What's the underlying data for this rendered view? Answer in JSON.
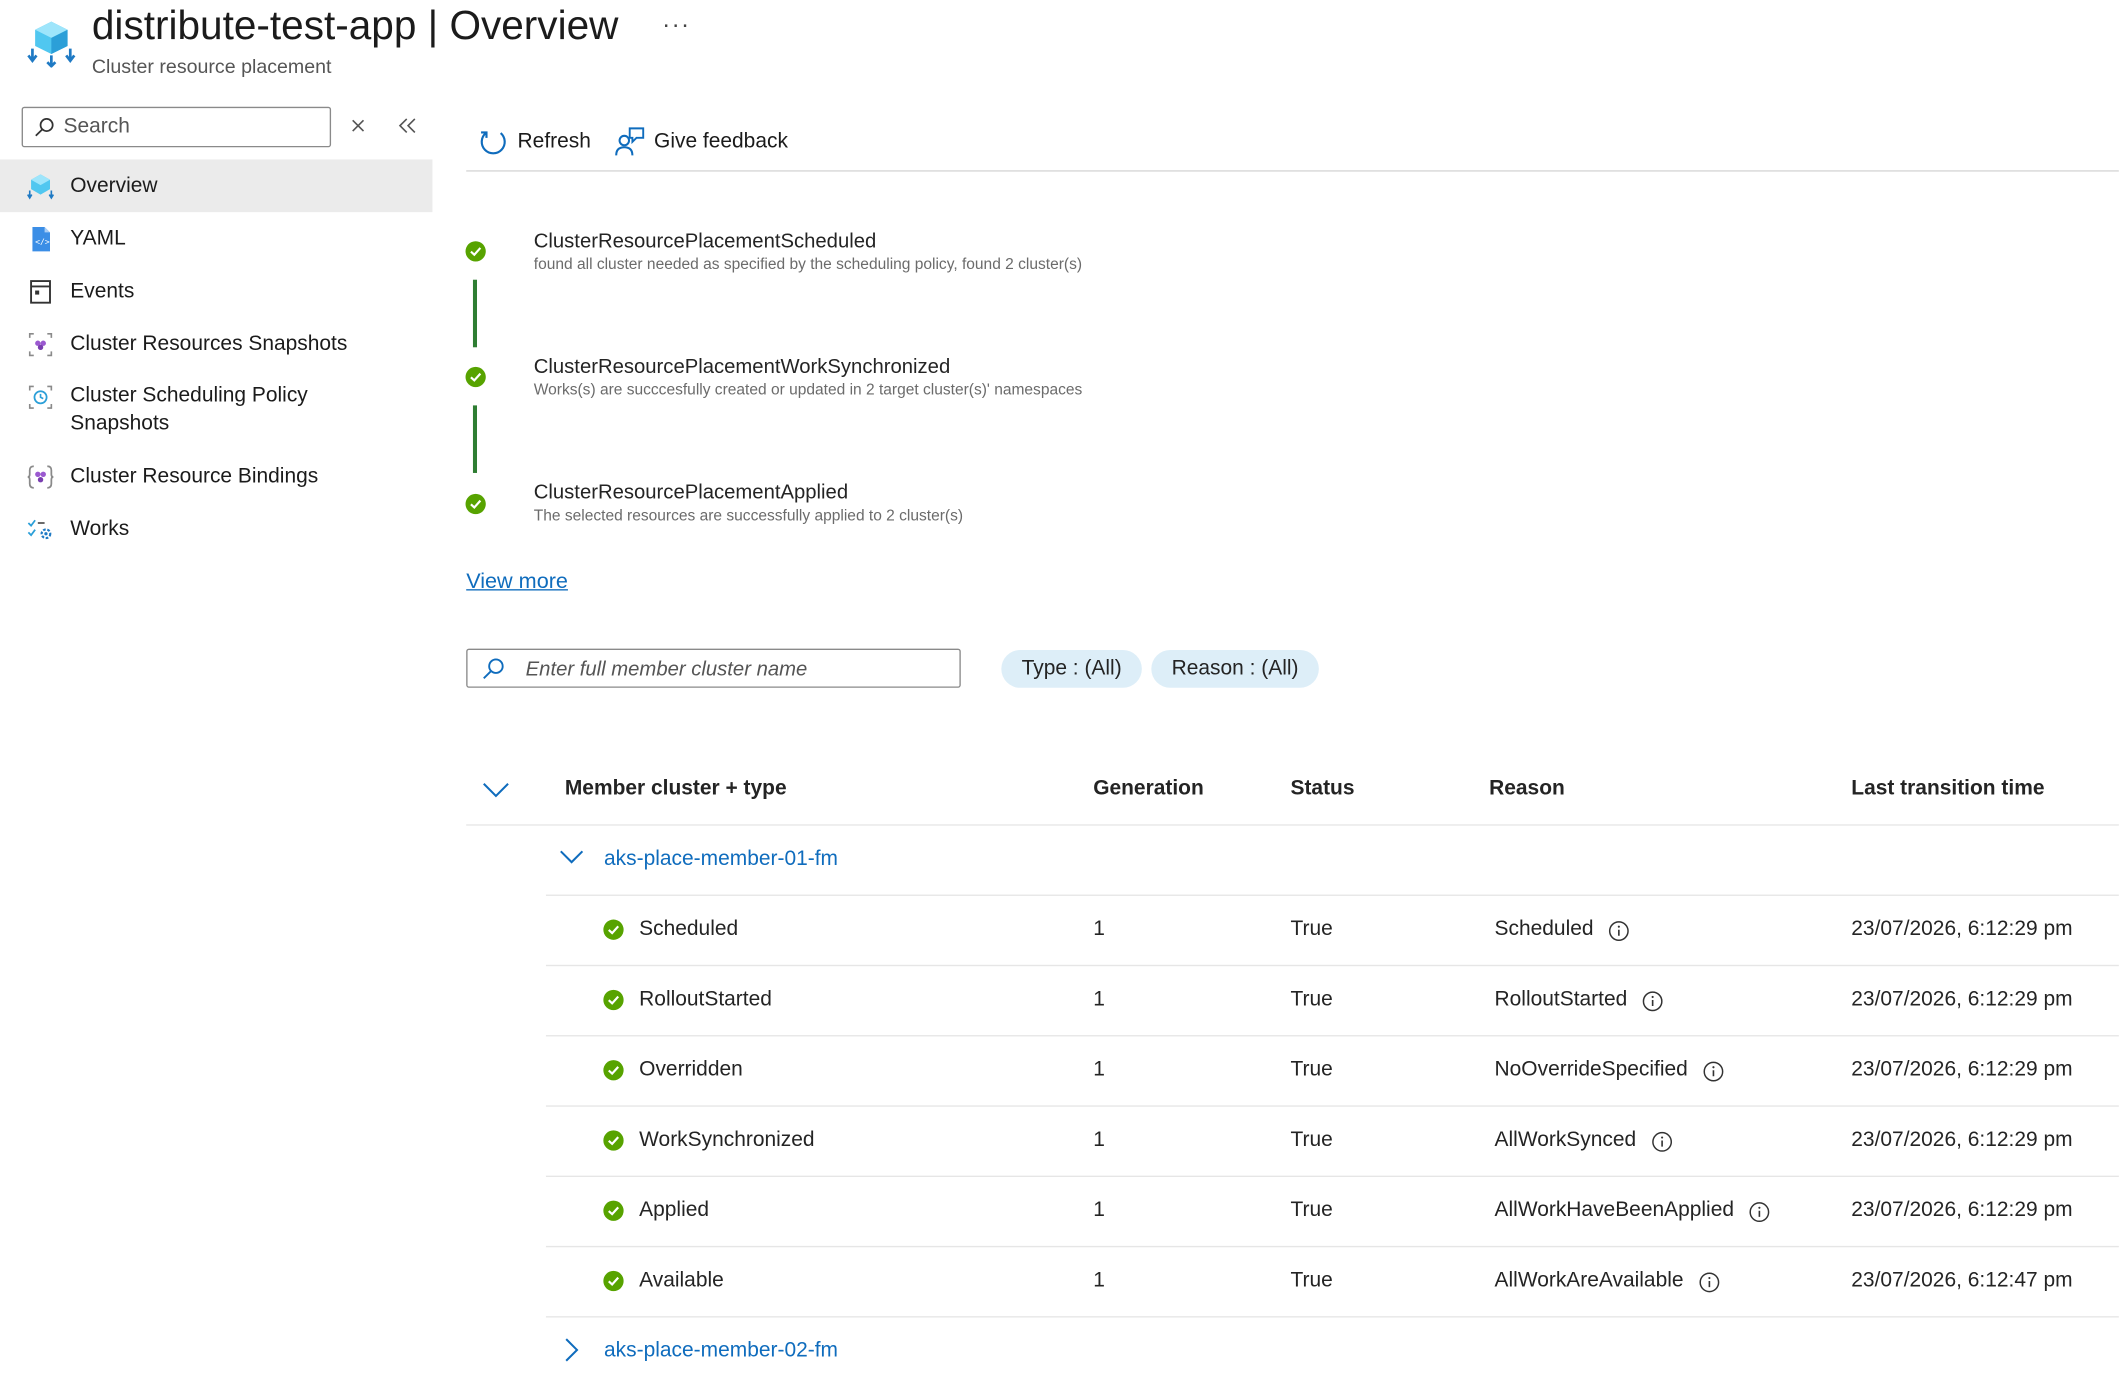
{
  "header": {
    "title": "distribute-test-app",
    "title_separator": "|",
    "section": "Overview",
    "subtitle": "Cluster resource placement",
    "more": "···"
  },
  "sidebar": {
    "search_placeholder": "Search",
    "items": [
      {
        "label": "Overview",
        "icon": "cluster-placement-icon",
        "active": true
      },
      {
        "label": "YAML",
        "icon": "yaml-file-icon"
      },
      {
        "label": "Events",
        "icon": "events-icon"
      },
      {
        "label": "Cluster Resources Snapshots",
        "icon": "resource-snapshot-icon"
      },
      {
        "label": "Cluster Scheduling Policy",
        "label2": "Snapshots",
        "icon": "policy-snapshot-icon"
      },
      {
        "label": "Cluster Resource Bindings",
        "icon": "resource-bindings-icon"
      },
      {
        "label": "Works",
        "icon": "works-icon"
      }
    ]
  },
  "toolbar": {
    "refresh": "Refresh",
    "feedback": "Give feedback"
  },
  "conditions": [
    {
      "title": "ClusterResourcePlacementScheduled",
      "description": "found all cluster needed as specified by the scheduling policy, found 2 cluster(s)"
    },
    {
      "title": "ClusterResourcePlacementWorkSynchronized",
      "description": "Works(s) are succcesfully created or updated in 2 target cluster(s)' namespaces"
    },
    {
      "title": "ClusterResourcePlacementApplied",
      "description": "The selected resources are successfully applied to 2 cluster(s)"
    }
  ],
  "view_more": "View more",
  "filters": {
    "cluster_placeholder": "Enter full member cluster name",
    "type_label": "Type : ",
    "type_value": "(All)",
    "reason_label": "Reason : ",
    "reason_value": "(All)"
  },
  "table": {
    "columns": [
      "Member cluster + type",
      "Generation",
      "Status",
      "Reason",
      "Last transition time"
    ],
    "groups": [
      {
        "name": "aks-place-member-01-fm",
        "expanded": true,
        "rows": [
          {
            "type": "Scheduled",
            "generation": "1",
            "status": "True",
            "reason": "Scheduled",
            "time": "23/07/2026, 6:12:29 pm"
          },
          {
            "type": "RolloutStarted",
            "generation": "1",
            "status": "True",
            "reason": "RolloutStarted",
            "time": "23/07/2026, 6:12:29 pm"
          },
          {
            "type": "Overridden",
            "generation": "1",
            "status": "True",
            "reason": "NoOverrideSpecified",
            "time": "23/07/2026, 6:12:29 pm"
          },
          {
            "type": "WorkSynchronized",
            "generation": "1",
            "status": "True",
            "reason": "AllWorkSynced",
            "time": "23/07/2026, 6:12:29 pm"
          },
          {
            "type": "Applied",
            "generation": "1",
            "status": "True",
            "reason": "AllWorkHaveBeenApplied",
            "time": "23/07/2026, 6:12:29 pm"
          },
          {
            "type": "Available",
            "generation": "1",
            "status": "True",
            "reason": "AllWorkAreAvailable",
            "time": "23/07/2026, 6:12:47 pm"
          }
        ]
      },
      {
        "name": "aks-place-member-02-fm",
        "expanded": false,
        "rows": []
      }
    ]
  },
  "colors": {
    "accent": "#0f6cbd",
    "success": "#57a300",
    "timeline": "#2e7d32",
    "active_nav": "#ebebeb",
    "pill": "#ddeef8"
  }
}
